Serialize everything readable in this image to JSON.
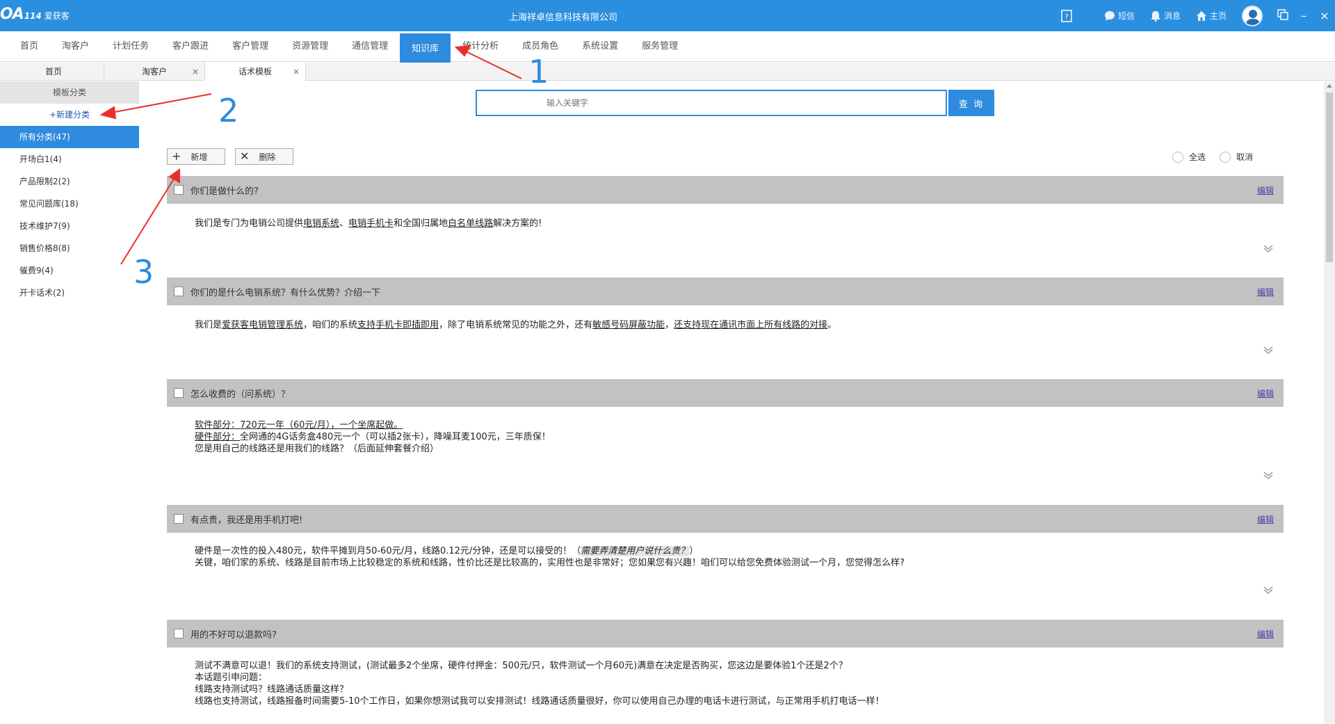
{
  "app": {
    "logo_mark": "OA",
    "logo_num": "114",
    "logo_text": "爱获客",
    "window_title": "上海祥卓信息科技有限公司",
    "sms_label": "短信",
    "msg_label": "消息",
    "home_label": "主页",
    "minimize": "–",
    "close": "×"
  },
  "nav": {
    "items": [
      "首页",
      "淘客户",
      "计划任务",
      "客户跟进",
      "客户管理",
      "资源管理",
      "通信管理",
      "知识库",
      "统计分析",
      "成员角色",
      "系统设置",
      "服务管理"
    ],
    "active_index": 7
  },
  "tabs": [
    {
      "label": "首页"
    },
    {
      "label": "淘客户",
      "close": "×"
    },
    {
      "label": "话术模板",
      "close": "×"
    }
  ],
  "sidebar": {
    "header": "模板分类",
    "new_label": "+新建分类",
    "items": [
      "所有分类(47)",
      "开场白1(4)",
      "产品限制2(2)",
      "常见问题库(18)",
      "技术维护7(9)",
      "销售价格8(8)",
      "催费9(4)",
      "开卡话术(2)"
    ],
    "active_index": 0
  },
  "search": {
    "placeholder": "输入关键字",
    "button": "查 询"
  },
  "toolbar": {
    "add_icon": "+",
    "add_label": "新增",
    "delete_icon": "✕",
    "delete_label": "删除"
  },
  "radios": {
    "select_all": "全选",
    "cancel": "取消"
  },
  "cards": [
    {
      "title": "你们是做什么的?",
      "edit": "编辑",
      "body": [
        "我们是专门为电销公司提供",
        "电销系统",
        "、",
        "电销手机卡",
        "和全国归属地",
        "白名单线路",
        "解决方案的!"
      ]
    },
    {
      "title": "你们的是什么电销系统？有什么优势？介绍一下",
      "edit": "编辑",
      "body": [
        "我们是",
        "爱获客电销管理系统",
        "，咱们的系统",
        "支持手机卡即插即用",
        "，除了电销系统常见的功能之外，还有",
        "敏感号码屏蔽功能",
        "，",
        "还支持现在通讯市面上所有线路的对接",
        "。"
      ]
    },
    {
      "title": "怎么收费的（问系统）？",
      "edit": "编辑",
      "lines": [
        [
          "软件部分：",
          "720元一年（60元/月），一个坐席起做。"
        ],
        [
          "硬件部分：",
          "全网通的4G话务盒480元一个（可以插2张卡），降噪耳麦100元，三年质保！"
        ],
        [
          "",
          "您是用自己的线路还是用我们的线路？（后面延伸套餐介绍）"
        ]
      ]
    },
    {
      "title": "有点贵，我还是用手机打吧!",
      "edit": "编辑",
      "line1": "硬件是一次性的投入480元，软件平摊到月50-60元/月，线路0.12元/分钟，还是可以接受的！（",
      "line1_em": "需要弄清楚用户说什么贵？",
      "line1_end": "）",
      "line2": "关键，咱们家的系统、线路是目前市场上比较稳定的系统和线路，性价比还是比较高的，实用性也是非常好；您如果您有兴趣！咱们可以给您免费体验测试一个月，您觉得怎么样?"
    },
    {
      "title": "用的不好可以退款吗?",
      "edit": "编辑",
      "lines": [
        "测试不满意可以退！我们的系统支持测试，(测试最多2个坐席，硬件付押金：500元/只，软件测试一个月60元)满意在决定是否购买，您这边是要体验1个还是2个？",
        "本话题引申问题：",
        "线路支持测试吗？线路通话质量这样？",
        "线路也支持测试，线路报备时间需要5-10个工作日，如果你想测试我可以安排测试！线路通话质量很好，你可以使用自己办理的电话卡进行测试，与正常用手机打电话一样！"
      ]
    }
  ],
  "annotations": [
    "1",
    "2",
    "3"
  ],
  "colors": {
    "primary": "#2e8be0",
    "titlebar": "#2b8fe0",
    "card_header": "#c2c2c2",
    "arrow": "#e8302a"
  }
}
